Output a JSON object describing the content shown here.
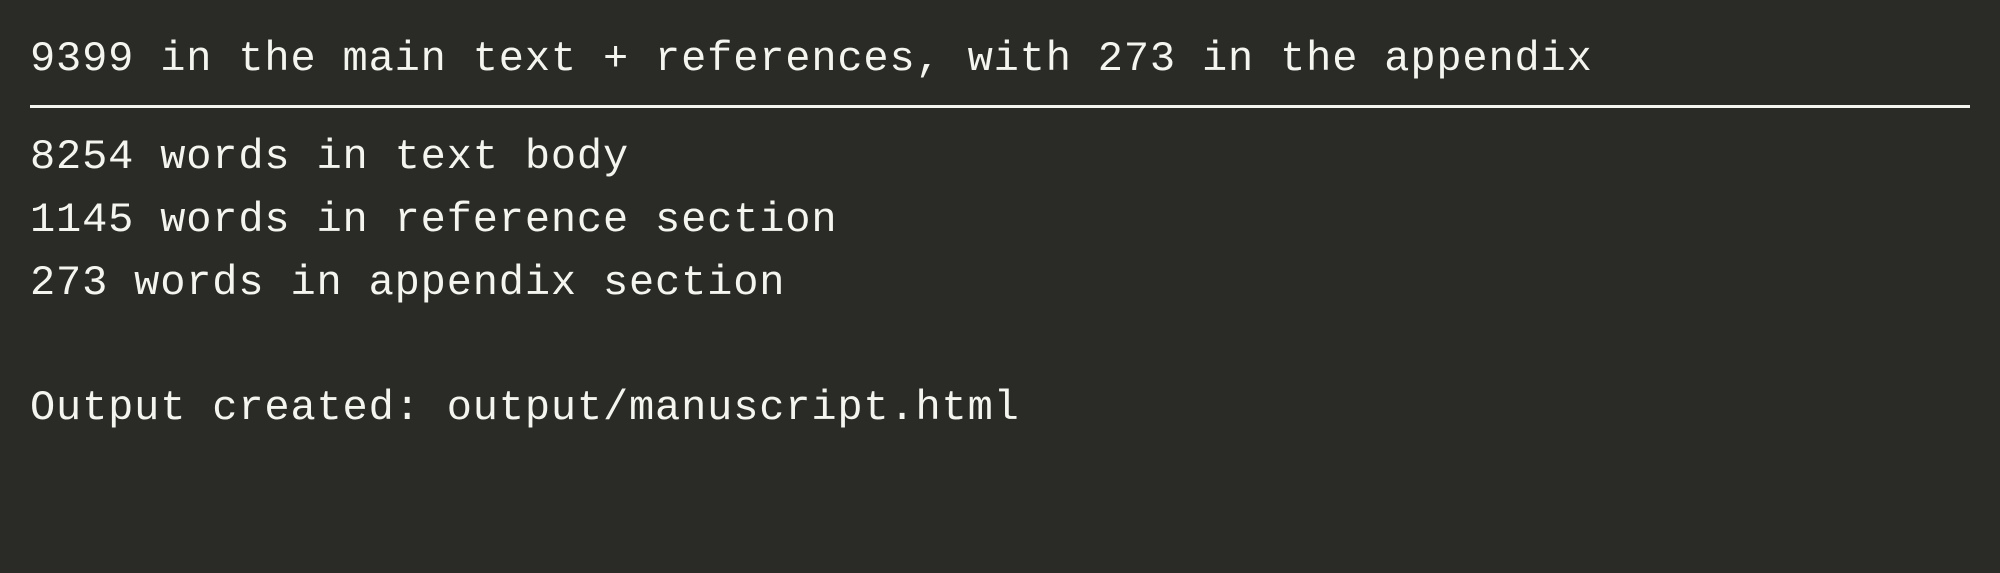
{
  "summary": "9399 in the main text + references, with 273 in the appendix",
  "details": [
    "8254 words in text body",
    "1145 words in reference section",
    "273 words in appendix section"
  ],
  "output_line": "Output created: output/manuscript.html"
}
